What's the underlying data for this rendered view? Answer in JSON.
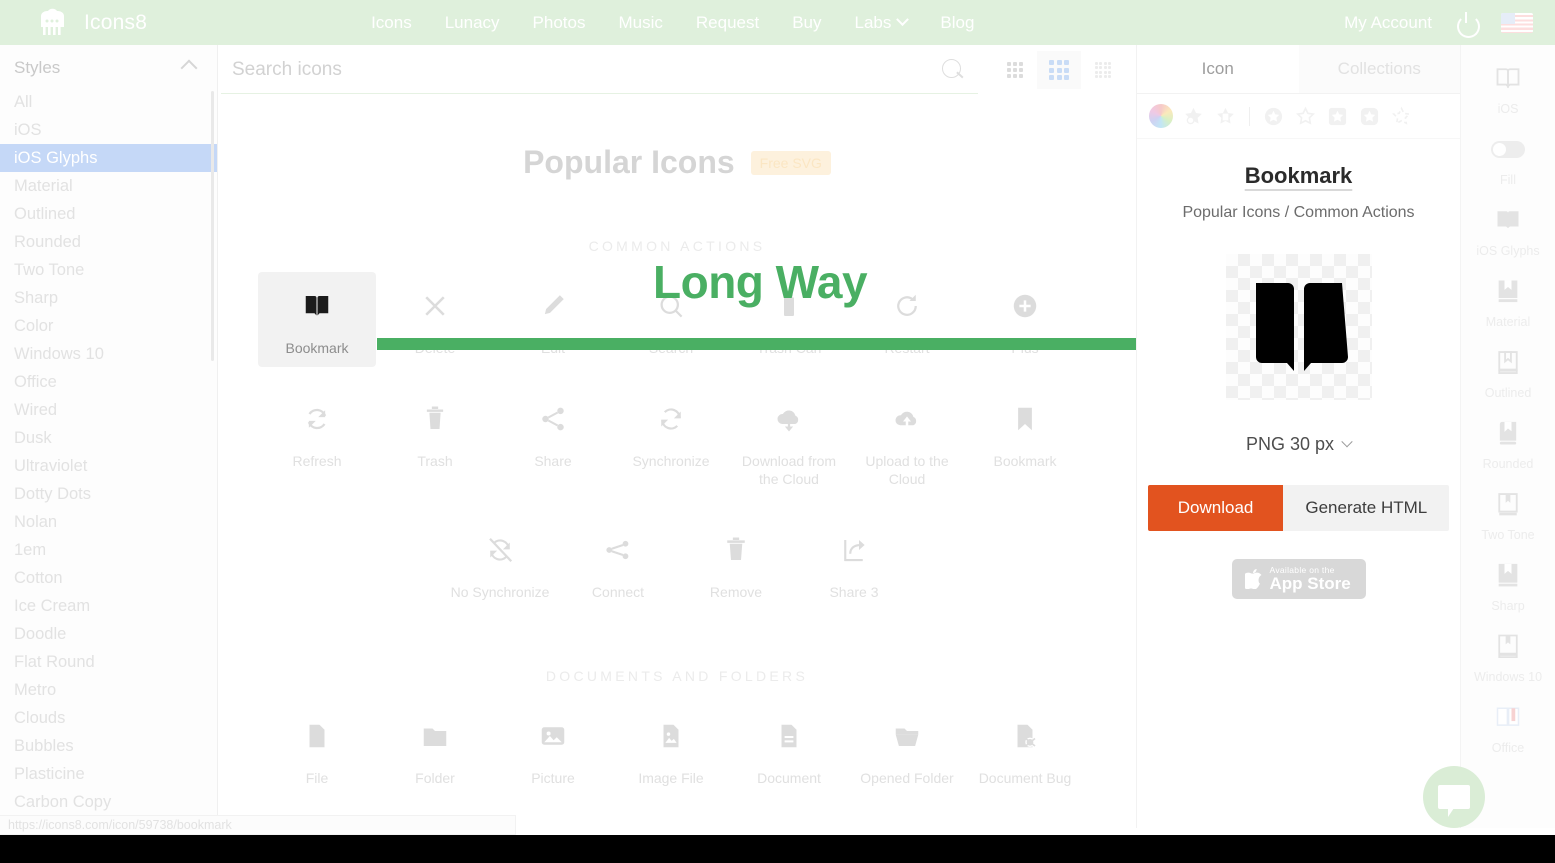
{
  "header": {
    "brand": "Icons8",
    "logo_icon": "icons8-robot-logo",
    "nav": [
      {
        "label": "Icons",
        "dropdown": false
      },
      {
        "label": "Lunacy",
        "dropdown": false
      },
      {
        "label": "Photos",
        "dropdown": false
      },
      {
        "label": "Music",
        "dropdown": false
      },
      {
        "label": "Request",
        "dropdown": false
      },
      {
        "label": "Buy",
        "dropdown": false
      },
      {
        "label": "Labs",
        "dropdown": true
      },
      {
        "label": "Blog",
        "dropdown": false
      }
    ],
    "account": "My Account",
    "power_icon": "power-icon",
    "flag_icon": "us-flag-icon",
    "bg_color": "#dff0dc"
  },
  "sidebar": {
    "title": "Styles",
    "collapse_icon": "chevron-up-icon",
    "active": "iOS Glyphs",
    "items": [
      "All",
      "iOS",
      "iOS Glyphs",
      "Material",
      "Outlined",
      "Rounded",
      "Two Tone",
      "Sharp",
      "Color",
      "Windows 10",
      "Office",
      "Wired",
      "Dusk",
      "Ultraviolet",
      "Dotty Dots",
      "Nolan",
      "1em",
      "Cotton",
      "Ice Cream",
      "Doodle",
      "Flat Round",
      "Metro",
      "Clouds",
      "Bubbles",
      "Plasticine",
      "Carbon Copy"
    ]
  },
  "search": {
    "placeholder": "Search icons",
    "value": "",
    "search_icon": "search-icon",
    "views": [
      {
        "name": "grid-small-view",
        "active": false
      },
      {
        "name": "grid-medium-view",
        "active": true
      },
      {
        "name": "grid-large-view",
        "active": false
      }
    ]
  },
  "main": {
    "title": "Popular Icons",
    "badge": "Free SVG",
    "sections": [
      {
        "label": "COMMON ACTIONS",
        "rows": [
          [
            {
              "label": "Bookmark",
              "icon": "bookmark-book-icon",
              "selected": true
            },
            {
              "label": "Delete",
              "icon": "close-x-icon",
              "selected": false
            },
            {
              "label": "Edit",
              "icon": "pencil-icon",
              "selected": false
            },
            {
              "label": "Search",
              "icon": "search-icon",
              "selected": false
            },
            {
              "label": "Trash Can",
              "icon": "trash-can-icon",
              "selected": false
            },
            {
              "label": "Restart",
              "icon": "restart-icon",
              "selected": false
            },
            {
              "label": "Plus",
              "icon": "plus-circle-icon",
              "selected": false
            }
          ],
          [
            {
              "label": "Refresh",
              "icon": "refresh-icon",
              "selected": false
            },
            {
              "label": "Trash",
              "icon": "trash-icon",
              "selected": false
            },
            {
              "label": "Share",
              "icon": "share-icon",
              "selected": false
            },
            {
              "label": "Synchronize",
              "icon": "synchronize-icon",
              "selected": false
            },
            {
              "label": "Download from the Cloud",
              "icon": "cloud-download-icon",
              "selected": false
            },
            {
              "label": "Upload to the Cloud",
              "icon": "cloud-upload-icon",
              "selected": false
            },
            {
              "label": "Bookmark",
              "icon": "bookmark-ribbon-icon",
              "selected": false
            }
          ],
          [
            {
              "label": "No Synchronize",
              "icon": "no-synchronize-icon",
              "selected": false
            },
            {
              "label": "Connect",
              "icon": "connect-icon",
              "selected": false
            },
            {
              "label": "Remove",
              "icon": "remove-trash-icon",
              "selected": false
            },
            {
              "label": "Share 3",
              "icon": "share-3-icon",
              "selected": false
            }
          ]
        ]
      },
      {
        "label": "DOCUMENTS AND FOLDERS",
        "rows": [
          [
            {
              "label": "File",
              "icon": "file-icon",
              "selected": false
            },
            {
              "label": "Folder",
              "icon": "folder-icon",
              "selected": false
            },
            {
              "label": "Picture",
              "icon": "picture-icon",
              "selected": false
            },
            {
              "label": "Image File",
              "icon": "image-file-icon",
              "selected": false
            },
            {
              "label": "Document",
              "icon": "document-icon",
              "selected": false
            },
            {
              "label": "Opened Folder",
              "icon": "opened-folder-icon",
              "selected": false
            },
            {
              "label": "Document Bug",
              "icon": "document-bug-icon",
              "selected": false
            }
          ]
        ]
      }
    ]
  },
  "annotation": {
    "text": "Long Way",
    "color": "#4aaf63",
    "arrow_icon": "right-arrow-annotation"
  },
  "panel": {
    "tabs": [
      {
        "label": "Icon",
        "active": true
      },
      {
        "label": "Collections",
        "active": false
      }
    ],
    "style_icons": [
      "color-wheel-icon",
      "star-shadow-icon",
      "star-badge-icon",
      "star-circle-icon",
      "star-outline-icon",
      "star-square-icon",
      "star-rounded-icon",
      "star-dashed-icon"
    ],
    "icon_name": "Bookmark",
    "breadcrumb": "Popular Icons / Common Actions",
    "preview_icon": "bookmark-book-glyph",
    "format": "PNG 30 px",
    "format_chevron": "chevron-down-icon",
    "download_label": "Download",
    "generate_label": "Generate HTML",
    "download_color": "#e2531f",
    "appstore": {
      "small": "Available on the",
      "big": "App Store",
      "icon": "apple-logo-icon"
    }
  },
  "rail": [
    {
      "label": "iOS",
      "icon": "book-outline-icon",
      "toggle": false
    },
    {
      "label": "Fill",
      "icon": "fill-toggle",
      "toggle": true
    },
    {
      "label": "iOS Glyphs",
      "icon": "book-filled-icon",
      "toggle": false
    },
    {
      "label": "Material",
      "icon": "bookmark-material-icon",
      "toggle": false
    },
    {
      "label": "Outlined",
      "icon": "bookmark-outlined-icon",
      "toggle": false
    },
    {
      "label": "Rounded",
      "icon": "bookmark-rounded-icon",
      "toggle": false
    },
    {
      "label": "Two Tone",
      "icon": "bookmark-two-tone-icon",
      "toggle": false
    },
    {
      "label": "Sharp",
      "icon": "bookmark-sharp-icon",
      "toggle": false
    },
    {
      "label": "Windows 10",
      "icon": "bookmark-win10-icon",
      "toggle": false
    },
    {
      "label": "Office",
      "icon": "bookmark-office-icon",
      "toggle": false
    }
  ],
  "fab": {
    "icon": "chat-bubble-icon"
  },
  "statusbar": {
    "url": "https://icons8.com/icon/59738/bookmark"
  }
}
